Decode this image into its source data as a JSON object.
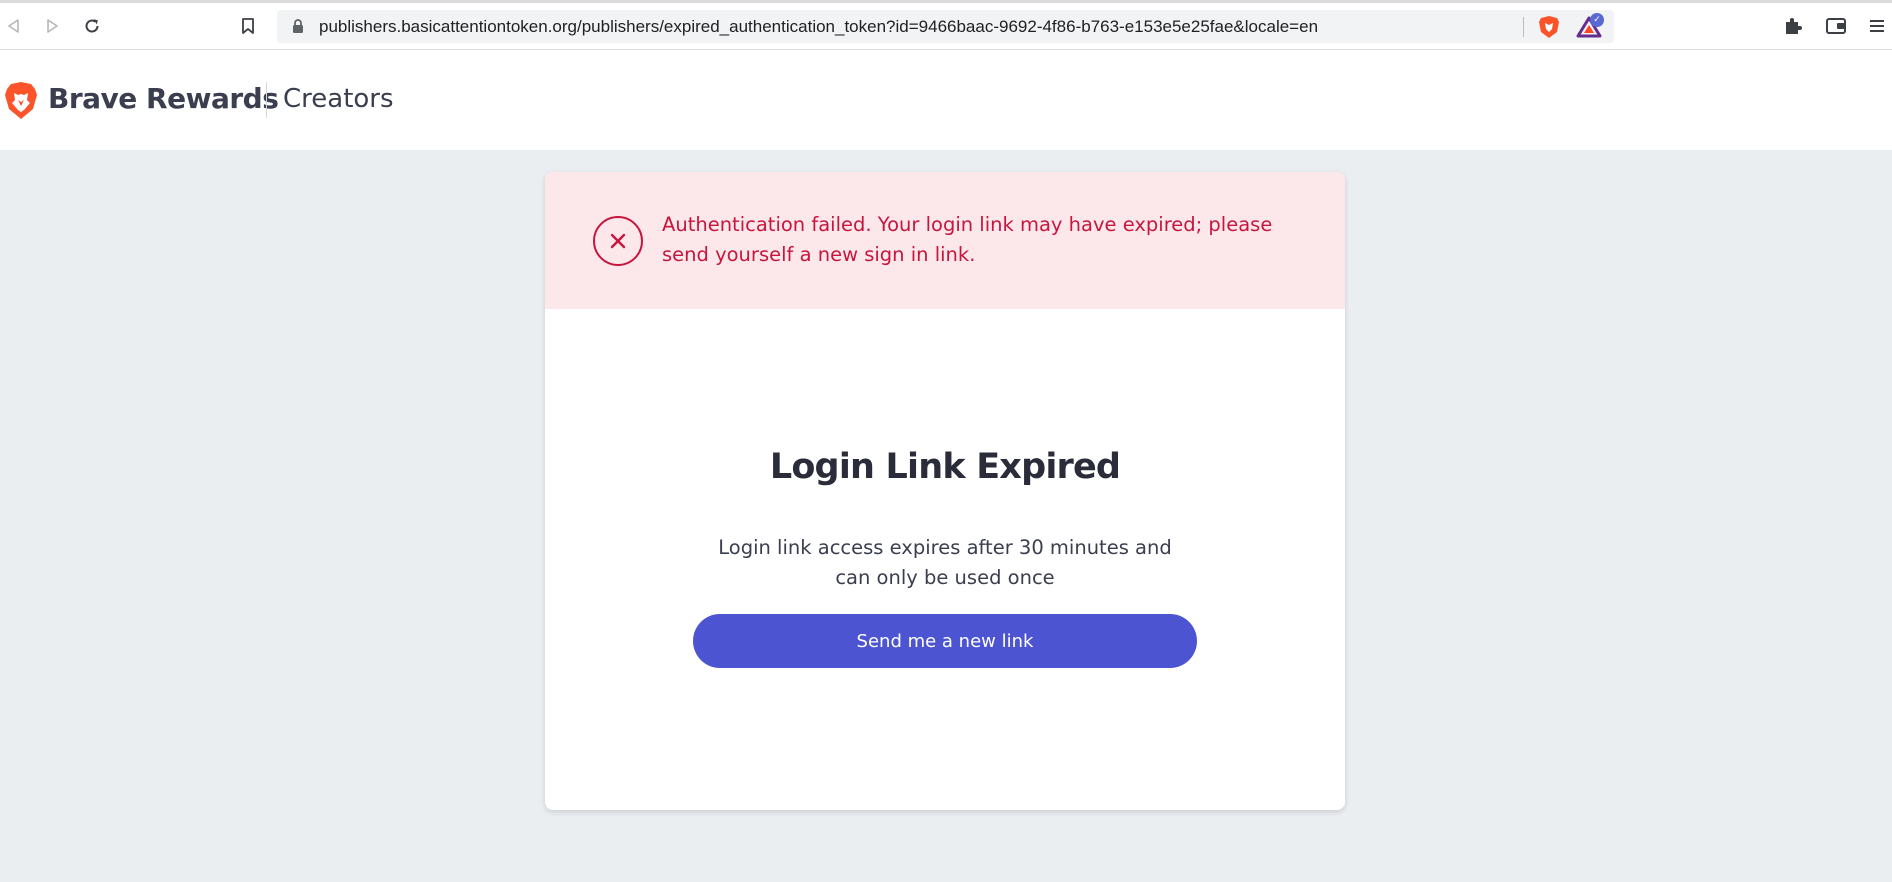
{
  "browser": {
    "url": "publishers.basicattentiontoken.org/publishers/expired_authentication_token?id=9466baac-9692-4f86-b763-e153e5e25fae&locale=en",
    "extension_badge": "✓"
  },
  "header": {
    "brand_name": "Brave Rewards",
    "brand_sub": "Creators"
  },
  "alert": {
    "message": "Authentication failed. Your login link may have expired; please send yourself a new sign in link."
  },
  "card": {
    "title": "Login Link Expired",
    "description": "Login link access expires after 30 minutes and can only be used once",
    "button_label": "Send me a new link"
  },
  "colors": {
    "brand_orange": "#fb542b",
    "error_red": "#c8153e",
    "alert_bg": "#fce8ea",
    "button_bg": "#4c54d2",
    "page_bg": "#ebeef1"
  },
  "icons": {
    "back": "arrow-left-icon",
    "forward": "arrow-right-icon",
    "reload": "reload-icon",
    "bookmark": "bookmark-icon",
    "lock": "lock-icon",
    "brave_shield": "brave-shield-icon",
    "bat_rewards": "bat-rewards-icon",
    "extensions": "puzzle-icon",
    "wallet": "wallet-icon",
    "menu": "menu-icon",
    "brand": "brave-lion-icon",
    "error": "close-circle-icon"
  }
}
